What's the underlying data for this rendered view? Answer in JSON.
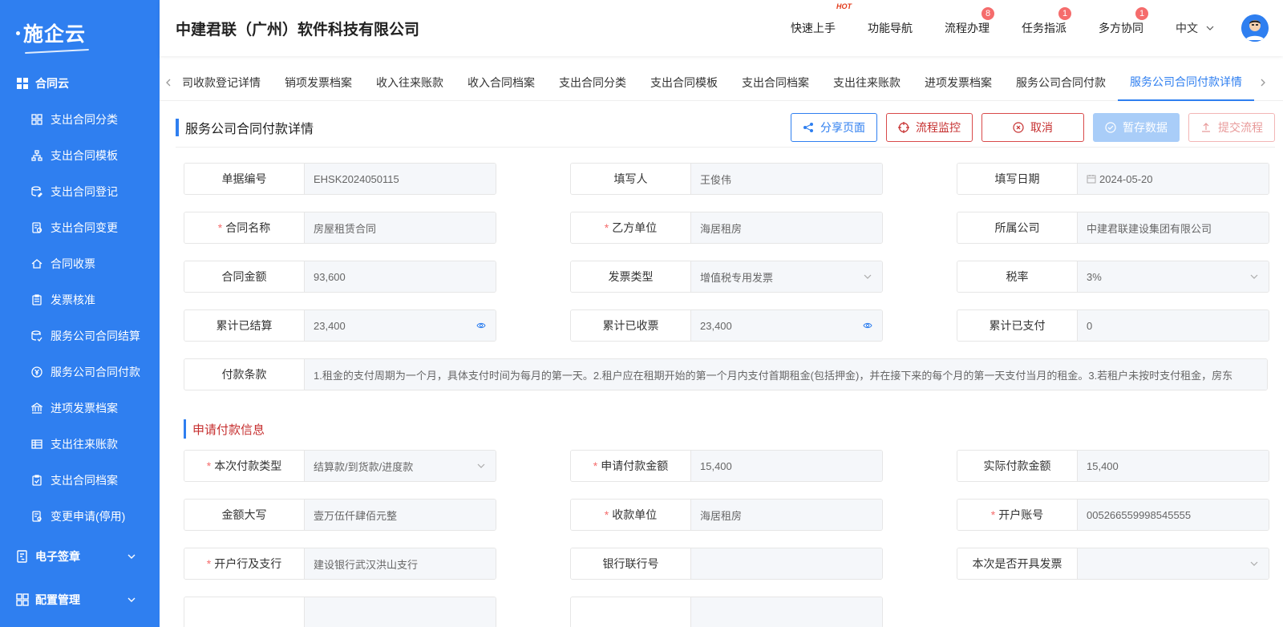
{
  "app": {
    "logo": "施企云",
    "company": "中建君联（广州）软件科技有限公司"
  },
  "header": {
    "nav": [
      {
        "label": "快速上手",
        "hot": "HOT"
      },
      {
        "label": "功能导航"
      },
      {
        "label": "流程办理",
        "badge": "8"
      },
      {
        "label": "任务指派",
        "badge": "1"
      },
      {
        "label": "多方协同",
        "badge": "1"
      }
    ],
    "lang": "中文"
  },
  "sidebar": {
    "group": "合同云",
    "items": [
      {
        "label": "支出合同分类",
        "icon": "grid-icon"
      },
      {
        "label": "支出合同模板",
        "icon": "sitemap-icon"
      },
      {
        "label": "支出合同登记",
        "icon": "database-edit-icon"
      },
      {
        "label": "支出合同变更",
        "icon": "document-change-icon"
      },
      {
        "label": "合同收票",
        "icon": "home-ticket-icon"
      },
      {
        "label": "发票核准",
        "icon": "clipboard-icon"
      },
      {
        "label": "服务公司合同结算",
        "icon": "database-check-icon"
      },
      {
        "label": "服务公司合同付款",
        "icon": "yen-circle-icon"
      },
      {
        "label": "进项发票档案",
        "icon": "bank-icon"
      },
      {
        "label": "支出往来账款",
        "icon": "ledger-icon"
      },
      {
        "label": "支出合同档案",
        "icon": "clipboard-check-icon"
      },
      {
        "label": "变更申请(停用)",
        "icon": "document-settings-icon"
      }
    ],
    "collapsed": [
      {
        "label": "电子签章"
      },
      {
        "label": "配置管理"
      }
    ]
  },
  "tabs": [
    {
      "label": "司收款登记详情"
    },
    {
      "label": "销项发票档案"
    },
    {
      "label": "收入往来账款"
    },
    {
      "label": "收入合同档案"
    },
    {
      "label": "支出合同分类"
    },
    {
      "label": "支出合同模板"
    },
    {
      "label": "支出合同档案"
    },
    {
      "label": "支出往来账款"
    },
    {
      "label": "进项发票档案"
    },
    {
      "label": "服务公司合同付款"
    },
    {
      "label": "服务公司合同付款详情",
      "active": true
    }
  ],
  "page": {
    "title": "服务公司合同付款详情",
    "buttons": {
      "share": "分享页面",
      "monitor": "流程监控",
      "cancel": "取消",
      "save": "暂存数据",
      "submit": "提交流程"
    }
  },
  "form": {
    "doc_no": {
      "label": "单据编号",
      "value": "EHSK2024050115"
    },
    "filler": {
      "label": "填写人",
      "value": "王俊伟"
    },
    "fill_date": {
      "label": "填写日期",
      "value": "2024-05-20"
    },
    "contract_name": {
      "label": "合同名称",
      "value": "房屋租赁合同",
      "required": "*"
    },
    "party_b": {
      "label": "乙方单位",
      "value": "海居租房",
      "required": "*"
    },
    "company": {
      "label": "所属公司",
      "value": "中建君联建设集团有限公司"
    },
    "amount": {
      "label": "合同金额",
      "value": "93,600"
    },
    "invoice_type": {
      "label": "发票类型",
      "value": "增值税专用发票"
    },
    "tax_rate": {
      "label": "税率",
      "value": "3%"
    },
    "settled": {
      "label": "累计已结算",
      "value": "23,400"
    },
    "invoiced": {
      "label": "累计已收票",
      "value": "23,400"
    },
    "paid": {
      "label": "累计已支付",
      "value": "0"
    },
    "terms": {
      "label": "付款条款",
      "value": "1.租金的支付周期为一个月，具体支付时间为每月的第一天。2.租户应在租期开始的第一个月内支付首期租金(包括押金)，并在接下来的每个月的第一天支付当月的租金。3.若租户未按时支付租金，房东"
    }
  },
  "payment": {
    "section_title": "申请付款信息",
    "pay_type": {
      "label": "本次付款类型",
      "value": "结算款/到货款/进度款",
      "required": "*"
    },
    "apply_amount": {
      "label": "申请付款金额",
      "value": "15,400",
      "required": "*"
    },
    "actual_amount": {
      "label": "实际付款金额",
      "value": "15,400"
    },
    "amount_upper": {
      "label": "金额大写",
      "value": "壹万伍仟肆佰元整"
    },
    "payee": {
      "label": "收款单位",
      "value": "海居租房",
      "required": "*"
    },
    "account": {
      "label": "开户账号",
      "value": "005266559998545555",
      "required": "*"
    },
    "bank": {
      "label": "开户行及支行",
      "value": "建设银行武汉洪山支行",
      "required": "*"
    },
    "bank_no": {
      "label": "银行联行号",
      "value": ""
    },
    "issue_invoice": {
      "label": "本次是否开具发票",
      "value": ""
    }
  },
  "colors": {
    "primary": "#2f7ff0",
    "danger": "#c62f2f",
    "badge": "#f56c6c"
  }
}
